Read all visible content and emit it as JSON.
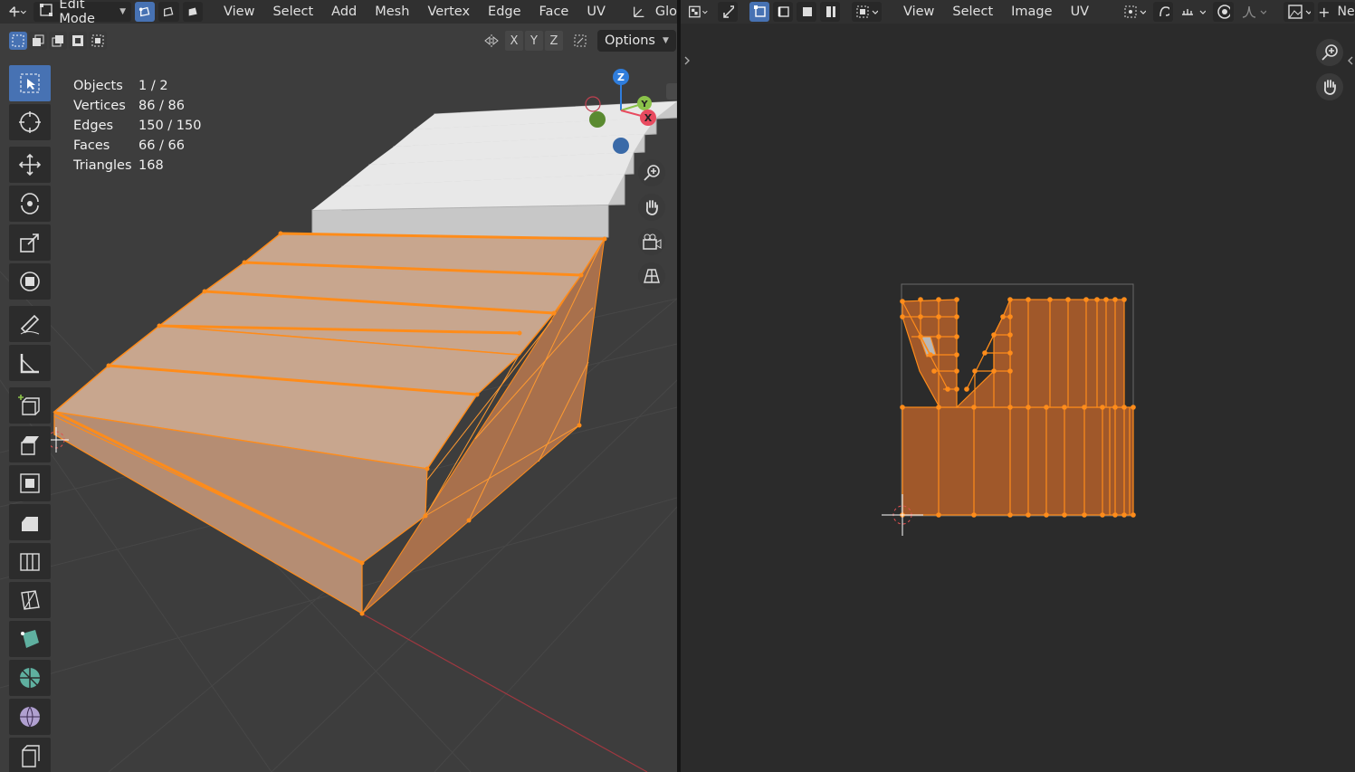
{
  "left_header": {
    "mode": "Edit Mode",
    "menus": [
      "View",
      "Select",
      "Add",
      "Mesh",
      "Vertex",
      "Edge",
      "Face",
      "UV"
    ],
    "transform_label": "Glo"
  },
  "subheader": {
    "axes": [
      "X",
      "Y",
      "Z"
    ],
    "options_label": "Options"
  },
  "stats": {
    "rows": [
      {
        "label": "Objects",
        "value": "1 / 2"
      },
      {
        "label": "Vertices",
        "value": "86 / 86"
      },
      {
        "label": "Edges",
        "value": "150 / 150"
      },
      {
        "label": "Faces",
        "value": "66 / 66"
      },
      {
        "label": "Triangles",
        "value": "168"
      }
    ]
  },
  "gizmo": {
    "z": "Z",
    "y": "Y",
    "x": "X"
  },
  "right_header": {
    "menus": [
      "View",
      "Select",
      "Image",
      "UV"
    ],
    "trailing_label": "Ne"
  },
  "colors": {
    "accent": "#4772b3",
    "selection": "#ff8c1a",
    "face_fill": "#a0582a",
    "x_axis": "#e84a5f",
    "y_axis": "#8bc24a",
    "z_axis": "#2f7ddc"
  }
}
